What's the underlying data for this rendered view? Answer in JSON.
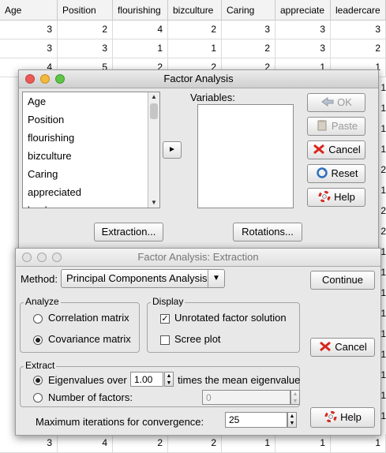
{
  "spreadsheet": {
    "columns": [
      "Age",
      "Position",
      "flourishing",
      "bizculture",
      "Caring",
      "appreciate",
      "leadercare"
    ],
    "rows": [
      [
        "3",
        "2",
        "4",
        "2",
        "3",
        "3",
        "3"
      ],
      [
        "3",
        "3",
        "1",
        "1",
        "2",
        "3",
        "2"
      ],
      [
        "4",
        "5",
        "2",
        "2",
        "2",
        "1",
        "1"
      ]
    ],
    "bottom_row": [
      "3",
      "4",
      "2",
      "2",
      "1",
      "1",
      "1"
    ],
    "right_edge_values": [
      "1",
      "1",
      "1",
      "1",
      "2",
      "1",
      "2",
      "2",
      "1",
      "1",
      "1",
      "1",
      "1",
      "1",
      "1",
      "1",
      "1"
    ]
  },
  "factor_window": {
    "title": "Factor Analysis",
    "variables_label": "Variables:",
    "source_items": [
      "Age",
      "Position",
      "flourishing",
      "bizculture",
      "Caring",
      "appreciated",
      "leadercare"
    ],
    "move_arrow": "►",
    "buttons": {
      "ok": "OK",
      "paste": "Paste",
      "cancel": "Cancel",
      "reset": "Reset",
      "help": "Help",
      "extraction": "Extraction...",
      "rotations": "Rotations..."
    }
  },
  "extraction_window": {
    "title": "Factor Analysis: Extraction",
    "method_label": "Method:",
    "method_value": "Principal Components Analysis",
    "analyze": {
      "legend": "Analyze",
      "correlation": "Correlation matrix",
      "covariance": "Covariance matrix",
      "selected": "covariance"
    },
    "display": {
      "legend": "Display",
      "unrotated": "Unrotated factor solution",
      "unrotated_checked": true,
      "scree": "Scree plot",
      "scree_checked": false
    },
    "extract": {
      "legend": "Extract",
      "eigen_label": "Eigenvalues over",
      "eigen_value": "1.00",
      "eigen_suffix": "times the mean eigenvalue",
      "nfactors_label": "Number of factors:",
      "nfactors_value": "0",
      "selected": "eigen"
    },
    "iterations_label": "Maximum iterations for convergence:",
    "iterations_value": "25",
    "buttons": {
      "continue": "Continue",
      "cancel": "Cancel",
      "help": "Help"
    }
  }
}
